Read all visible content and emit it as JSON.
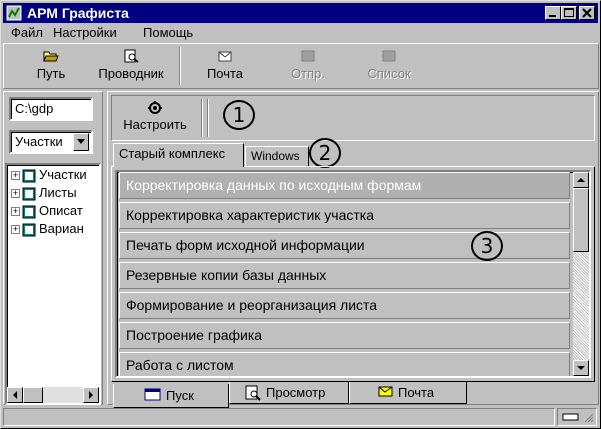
{
  "app": {
    "title": "АРМ Графиста"
  },
  "menu": [
    "Файл",
    "Настройки",
    "Помощь"
  ],
  "toolbar": {
    "path_label": "Путь",
    "explorer_label": "Проводник",
    "mail_label": "Почта",
    "send_label": "Отпр.",
    "list_label": "Список"
  },
  "sidebar": {
    "path_value": "C:\\gdp",
    "combo_value": "Участки",
    "tree": [
      "Участки",
      "Листы",
      "Описат",
      "Вариан"
    ]
  },
  "configure_label": "Настроить",
  "callouts": [
    "1",
    "2",
    "3"
  ],
  "tabs": [
    "Старый комплекс",
    "Windows"
  ],
  "tasks": [
    "Корректировка данных по исходным формам",
    "Корректировка характеристик участка",
    "Печать форм исходной информации",
    "Резервные копии базы данных",
    "Формирование и реорганизация листа",
    "Построение графика",
    "Работа с листом"
  ],
  "bottom_tabs": [
    "Пуск",
    "Просмотр",
    "Почта"
  ]
}
